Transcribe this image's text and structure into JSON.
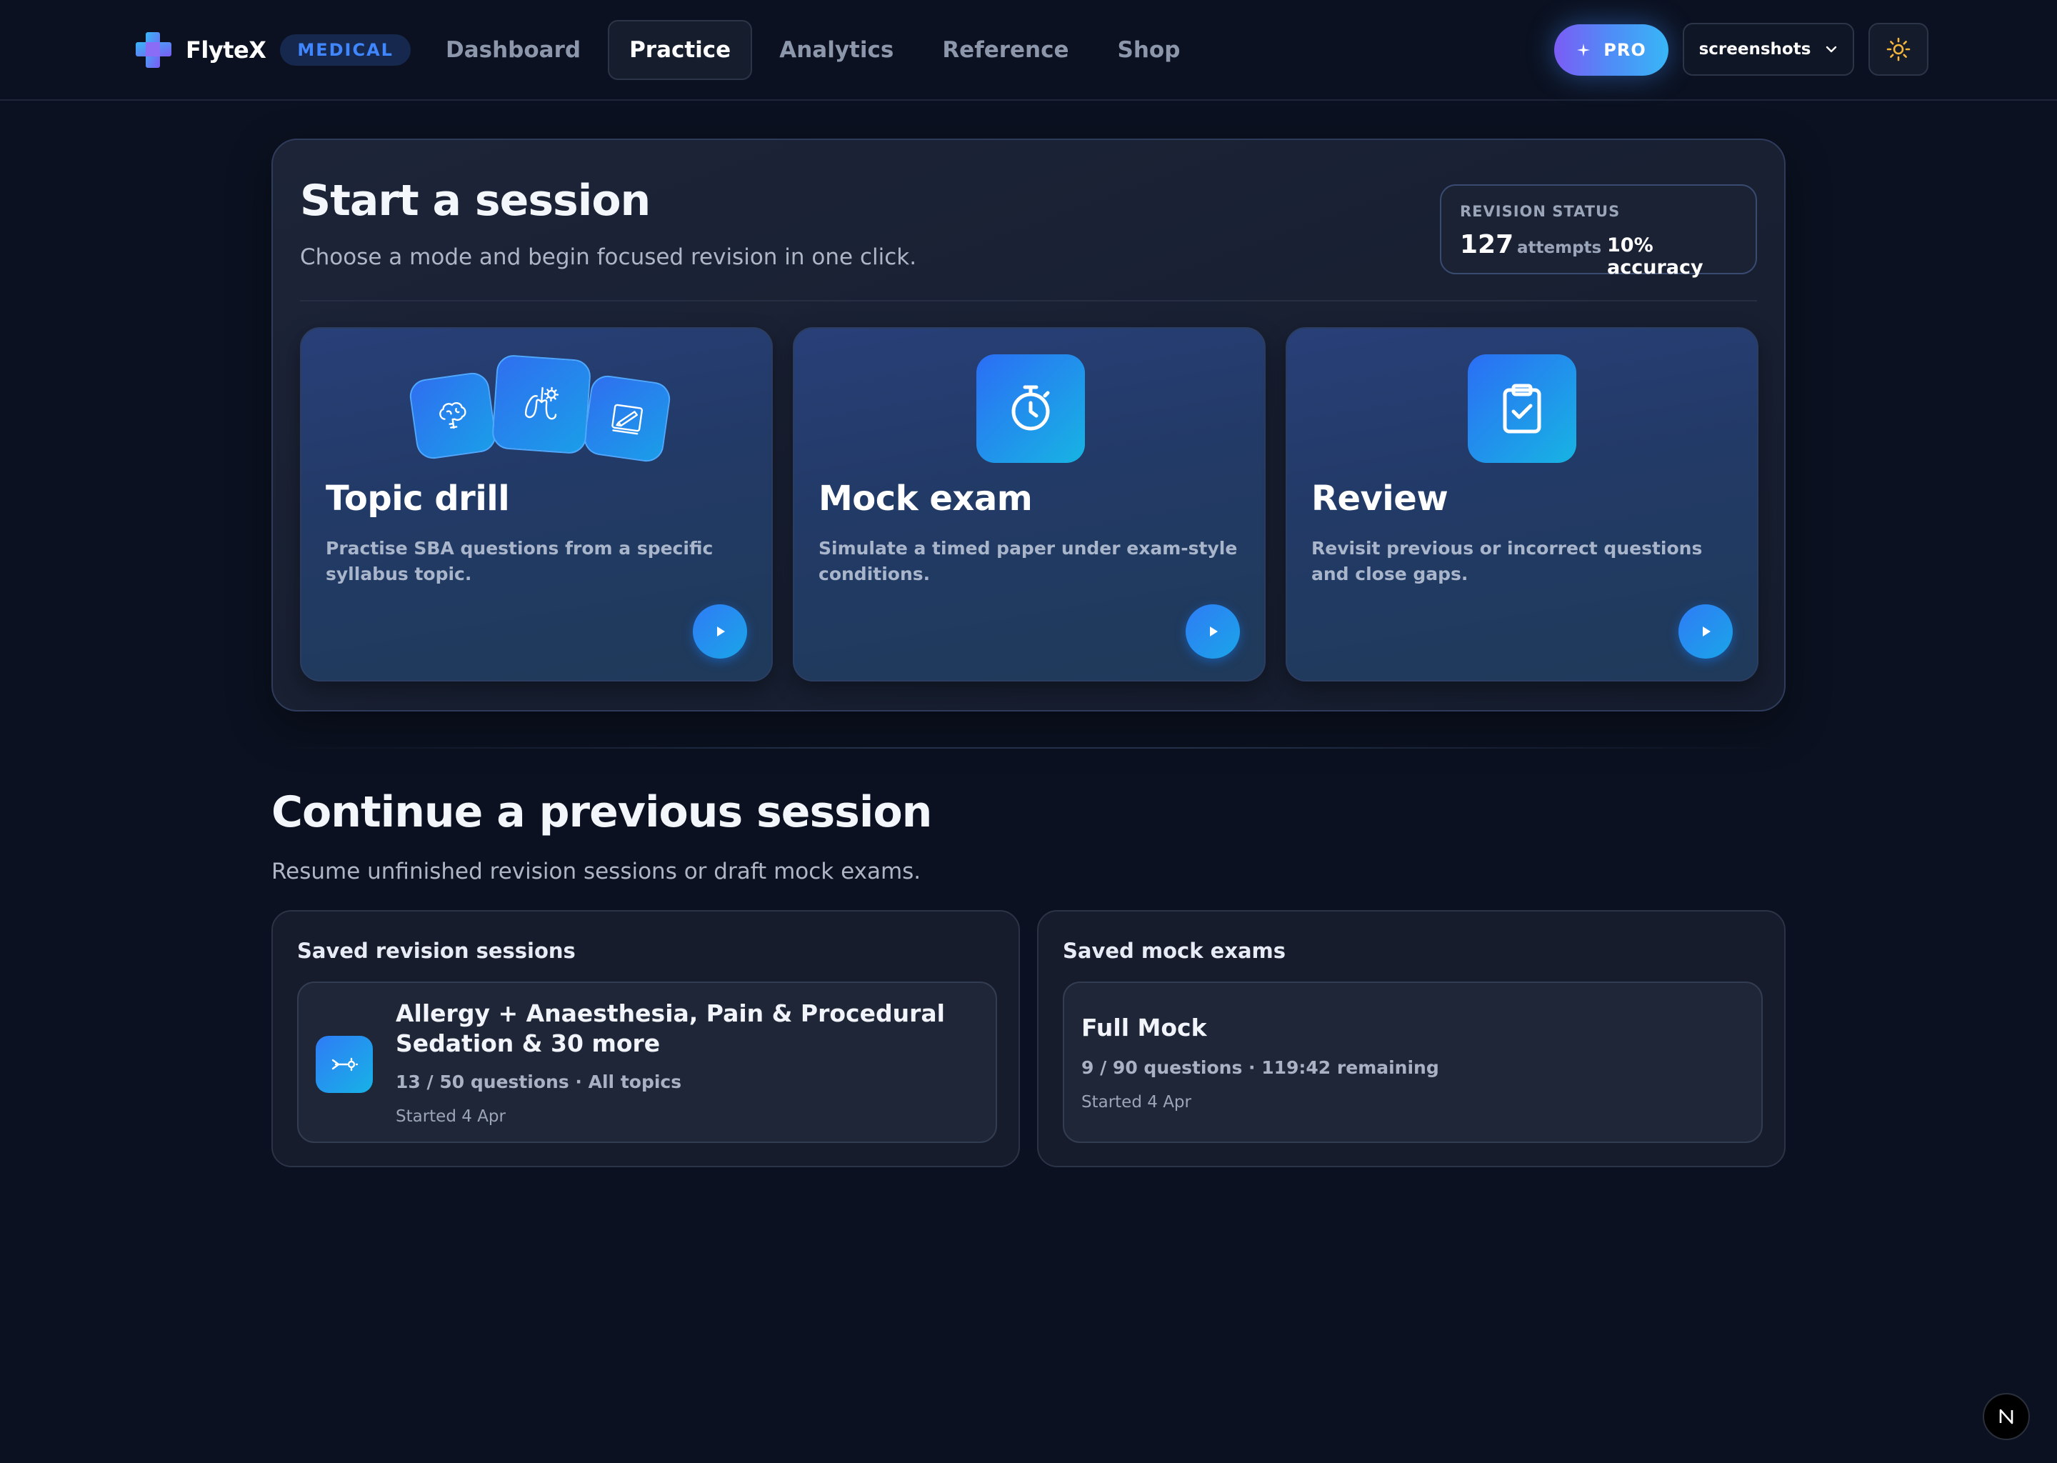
{
  "brand": {
    "name": "FlyteX",
    "badge": "MEDICAL"
  },
  "nav": {
    "links": [
      "Dashboard",
      "Practice",
      "Analytics",
      "Reference",
      "Shop"
    ],
    "active": "Practice"
  },
  "header": {
    "pro_label": "PRO",
    "account_label": "screenshots",
    "theme_icon": "sun-icon"
  },
  "start": {
    "title": "Start a session",
    "subtitle": "Choose a mode and begin focused revision in one click.",
    "status": {
      "label": "REVISION STATUS",
      "attempts": "127",
      "attempts_label": "attempts",
      "accuracy": "10% accuracy"
    },
    "modes": [
      {
        "title": "Topic drill",
        "description": "Practise SBA questions from a specific syllabus topic.",
        "icons": [
          "brain-icon",
          "lungs-icon",
          "scalpel-icon"
        ]
      },
      {
        "title": "Mock exam",
        "description": "Simulate a timed paper under exam-style conditions.",
        "icons": [
          "stopwatch-icon"
        ]
      },
      {
        "title": "Review",
        "description": "Revisit previous or incorrect questions and close gaps.",
        "icons": [
          "clipboard-check-icon"
        ]
      }
    ]
  },
  "continue": {
    "title": "Continue a previous session",
    "subtitle": "Resume unfinished revision sessions or draft mock exams.",
    "revision": {
      "heading": "Saved revision sessions",
      "item": {
        "title": "Allergy + Anaesthesia, Pain & Procedural Sedation & 30 more",
        "meta": "13 / 50 questions · All topics",
        "date": "Started 4 Apr",
        "icon": "syringe-icon"
      }
    },
    "mock": {
      "heading": "Saved mock exams",
      "item": {
        "title": "Full Mock",
        "meta": "9 / 90 questions · 119:42 remaining",
        "date": "Started 4 Apr"
      }
    }
  },
  "colors": {
    "background": "#0b1120",
    "accent": "#2f7cf6",
    "badge_text": "#3f86ff",
    "pro_gradient_start": "#7b5cf5",
    "pro_gradient_end": "#38b6f7"
  },
  "floating_badge": "N"
}
